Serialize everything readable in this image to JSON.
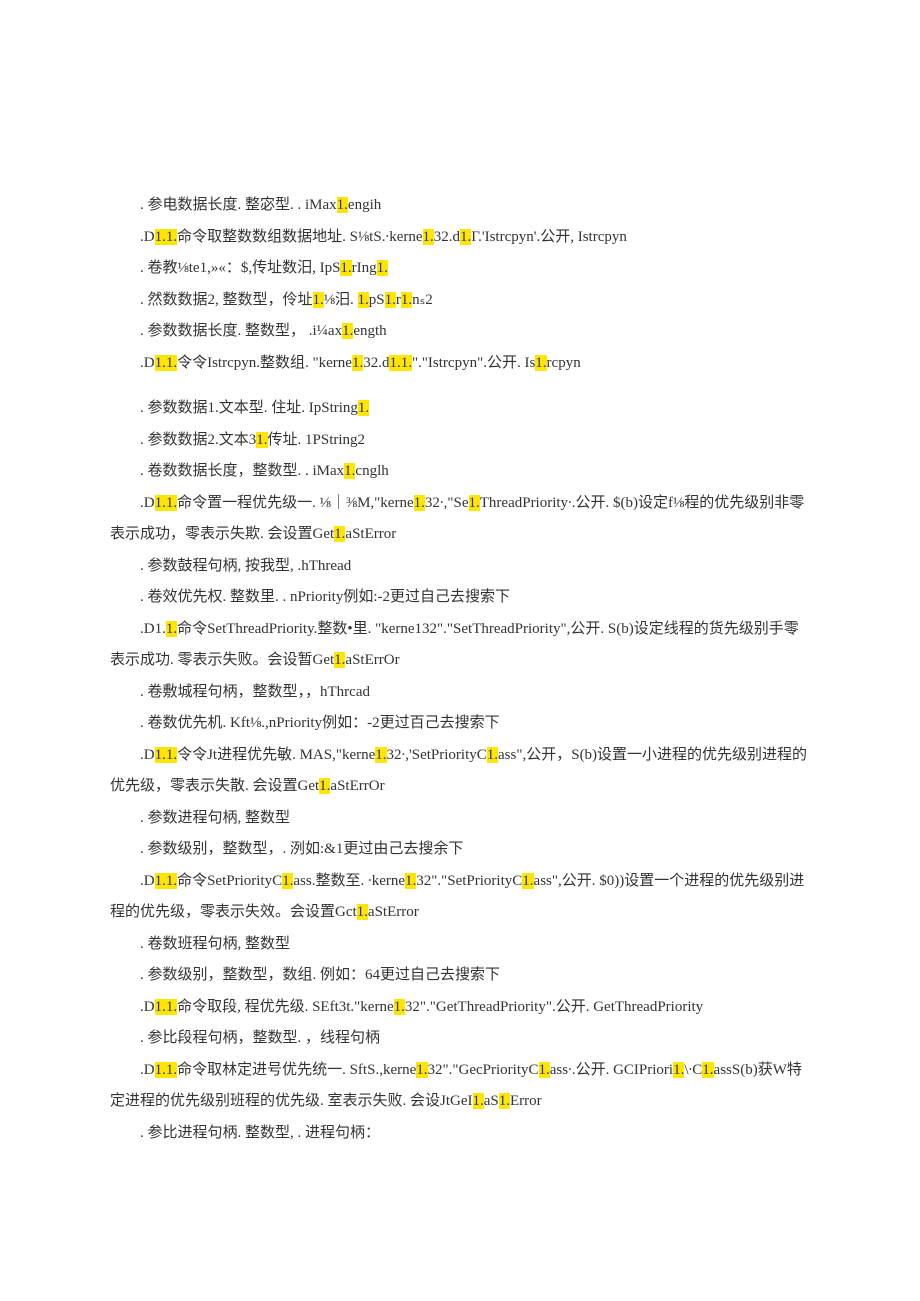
{
  "highlight_color": "#ffe600",
  "linesA": [
    {
      "parts": [
        {
          "t": ". 参电数据长度. 整宓型. . iMax",
          "hl": false
        },
        {
          "t": "1.",
          "hl": true
        },
        {
          "t": "engih",
          "hl": false
        }
      ]
    },
    {
      "parts": [
        {
          "t": ".D",
          "hl": false
        },
        {
          "t": "1.1.",
          "hl": true
        },
        {
          "t": "命令取整数数组数据地址. S⅛tS.∙kerne",
          "hl": false
        },
        {
          "t": "1.",
          "hl": true
        },
        {
          "t": "32.d",
          "hl": false
        },
        {
          "t": "1.",
          "hl": true
        },
        {
          "t": "Γ.'Istrcpyn'.公开, Istrcpyn",
          "hl": false
        }
      ]
    },
    {
      "parts": [
        {
          "t": ". 卷教⅛te1,»«：$,传址数汨, IpS",
          "hl": false
        },
        {
          "t": "1.",
          "hl": true
        },
        {
          "t": "rIng",
          "hl": false
        },
        {
          "t": "1.",
          "hl": true
        }
      ]
    },
    {
      "parts": [
        {
          "t": ". 然数数据2, 整数型，伶址",
          "hl": false
        },
        {
          "t": "1.",
          "hl": true
        },
        {
          "t": "⅛汨. ",
          "hl": false
        },
        {
          "t": "1.",
          "hl": true
        },
        {
          "t": "pS",
          "hl": false
        },
        {
          "t": "1.",
          "hl": true
        },
        {
          "t": "r",
          "hl": false
        },
        {
          "t": "1.",
          "hl": true
        },
        {
          "t": "nₛ2",
          "hl": false
        }
      ]
    },
    {
      "parts": [
        {
          "t": ". 参数数据长度. 整数型， .i¼ax",
          "hl": false
        },
        {
          "t": "1.",
          "hl": true
        },
        {
          "t": "ength",
          "hl": false
        }
      ]
    },
    {
      "parts": [
        {
          "t": ".D",
          "hl": false
        },
        {
          "t": "1.1.",
          "hl": true
        },
        {
          "t": "令令Istrcpyn.整数组. \"kerne",
          "hl": false
        },
        {
          "t": "1.",
          "hl": true
        },
        {
          "t": "32.d",
          "hl": false
        },
        {
          "t": "1.1.",
          "hl": true
        },
        {
          "t": "\".\"Istrcpyn\".公开. Is",
          "hl": false
        },
        {
          "t": "1.",
          "hl": true
        },
        {
          "t": "rcpyn",
          "hl": false
        }
      ]
    }
  ],
  "linesB": [
    {
      "parts": [
        {
          "t": ". 参数数据1.文本型. 住址. IpString",
          "hl": false
        },
        {
          "t": "1.",
          "hl": true
        }
      ]
    },
    {
      "parts": [
        {
          "t": ". 参数数据2.文本3",
          "hl": false
        },
        {
          "t": "1.",
          "hl": true
        },
        {
          "t": "传址. 1PString2",
          "hl": false
        }
      ]
    },
    {
      "parts": [
        {
          "t": ". 卷数数据长度，整数型. . iMax",
          "hl": false
        },
        {
          "t": "1.",
          "hl": true
        },
        {
          "t": "cnglh",
          "hl": false
        }
      ]
    },
    {
      "parts": [
        {
          "t": ".D",
          "hl": false
        },
        {
          "t": "1.1.",
          "hl": true
        },
        {
          "t": "命令置一程优先级一. ⅛｜⅜M,\"kerne",
          "hl": false
        },
        {
          "t": "1.",
          "hl": true
        },
        {
          "t": "32∙,\"Se",
          "hl": false
        },
        {
          "t": "1.",
          "hl": true
        },
        {
          "t": "ThreadPriority∙.公开. $(b)设定f⅛程的优先级别非零",
          "hl": false
        }
      ]
    },
    {
      "noindent": true,
      "parts": [
        {
          "t": "表示成功，零表示失欺. 会设置Get",
          "hl": false
        },
        {
          "t": "1.",
          "hl": true
        },
        {
          "t": "aStError",
          "hl": false
        }
      ]
    },
    {
      "parts": [
        {
          "t": ". 参数鼓程句柄, 按我型, .hThread",
          "hl": false
        }
      ]
    },
    {
      "parts": [
        {
          "t": ". 卷效优先权. 整数里. . nPriority例如:-2更过自己去搜索下",
          "hl": false
        }
      ]
    },
    {
      "parts": [
        {
          "t": ".D1.",
          "hl": false
        },
        {
          "t": "1.",
          "hl": true
        },
        {
          "t": "命令SetThreadPriority.整数•里. \"kerne132\".\"SetThreadPriority\",公开. S(b)设定线程的货先级别手零",
          "hl": false
        }
      ]
    },
    {
      "noindent": true,
      "parts": [
        {
          "t": "表示成功. 零表示失败。会设暂Get",
          "hl": false
        },
        {
          "t": "1.",
          "hl": true
        },
        {
          "t": "aStErrOr",
          "hl": false
        }
      ]
    },
    {
      "parts": [
        {
          "t": ". 卷敷城程句柄，整数型，，hThrcad",
          "hl": false
        }
      ]
    },
    {
      "parts": [
        {
          "t": ". 卷数优先机. Kft⅛.,nPriority例如：-2更过百己去搜索下",
          "hl": false
        }
      ]
    },
    {
      "parts": [
        {
          "t": ".D",
          "hl": false
        },
        {
          "t": "1.1.",
          "hl": true
        },
        {
          "t": "令令Jt进程优先敏. MAS,\"kerne",
          "hl": false
        },
        {
          "t": "1.",
          "hl": true
        },
        {
          "t": "32∙,'SetPriorityC",
          "hl": false
        },
        {
          "t": "1.",
          "hl": true
        },
        {
          "t": "ass\",公开，S(b)设置一小进程的优先级别进程的",
          "hl": false
        }
      ]
    },
    {
      "noindent": true,
      "parts": [
        {
          "t": "优先级，零表示失散. 会设置Get",
          "hl": false
        },
        {
          "t": "1.",
          "hl": true
        },
        {
          "t": "aStErrOr",
          "hl": false
        }
      ]
    },
    {
      "parts": [
        {
          "t": ". 参数进程句柄, 整数型",
          "hl": false
        }
      ]
    },
    {
      "parts": [
        {
          "t": ". 参数级别，整数型，. 洌如:&1更过由己去搜余下",
          "hl": false
        }
      ]
    },
    {
      "parts": [
        {
          "t": ".D",
          "hl": false
        },
        {
          "t": "1.1.",
          "hl": true
        },
        {
          "t": "命令SetPriorityC",
          "hl": false
        },
        {
          "t": "1.",
          "hl": true
        },
        {
          "t": "ass.整数至. ∙kerne",
          "hl": false
        },
        {
          "t": "1.",
          "hl": true
        },
        {
          "t": "32\".\"SetPriorityC",
          "hl": false
        },
        {
          "t": "1.",
          "hl": true
        },
        {
          "t": "ass\",公开. $0))设置一个进程的优先级别进",
          "hl": false
        }
      ]
    },
    {
      "noindent": true,
      "parts": [
        {
          "t": "程的优先级，零表示失效。会设置Gct",
          "hl": false
        },
        {
          "t": "1.",
          "hl": true
        },
        {
          "t": "aStError",
          "hl": false
        }
      ]
    },
    {
      "parts": [
        {
          "t": ". 卷数班程句柄, 整数型",
          "hl": false
        }
      ]
    },
    {
      "parts": [
        {
          "t": ". 参数级别，整数型，数组. 例如：64更过自己去搜索下",
          "hl": false
        }
      ]
    },
    {
      "parts": [
        {
          "t": ".D",
          "hl": false
        },
        {
          "t": "1.1.",
          "hl": true
        },
        {
          "t": "命令取段, 程优先级. SEft3t.\"kerne",
          "hl": false
        },
        {
          "t": "1.",
          "hl": true
        },
        {
          "t": "32\".\"GetThreadPriority\".公开. GetThreadPriority",
          "hl": false
        }
      ]
    },
    {
      "parts": [
        {
          "t": ". 参比段程句柄，整数型. ，线程句柄",
          "hl": false
        }
      ]
    },
    {
      "parts": [
        {
          "t": ".D",
          "hl": false
        },
        {
          "t": "1.1.",
          "hl": true
        },
        {
          "t": "命令取林定进号优先统一. SftS.,kerne",
          "hl": false
        },
        {
          "t": "1.",
          "hl": true
        },
        {
          "t": "32\".\"GecPriorityC",
          "hl": false
        },
        {
          "t": "1.",
          "hl": true
        },
        {
          "t": "ass∙.公开. GCIPriori",
          "hl": false
        },
        {
          "t": "1.",
          "hl": true
        },
        {
          "t": "\\∙C",
          "hl": false
        },
        {
          "t": "1.",
          "hl": true
        },
        {
          "t": "assS(b)获W特",
          "hl": false
        }
      ]
    },
    {
      "noindent": true,
      "parts": [
        {
          "t": "定进程的优先级别班程的优先级. 室表示失败. 会设JtGeI",
          "hl": false
        },
        {
          "t": "1.",
          "hl": true
        },
        {
          "t": "aS",
          "hl": false
        },
        {
          "t": "1.",
          "hl": true
        },
        {
          "t": "Error",
          "hl": false
        }
      ]
    },
    {
      "parts": [
        {
          "t": ". 参比进程句柄. 整数型, . 进程句柄：",
          "hl": false
        }
      ]
    }
  ]
}
